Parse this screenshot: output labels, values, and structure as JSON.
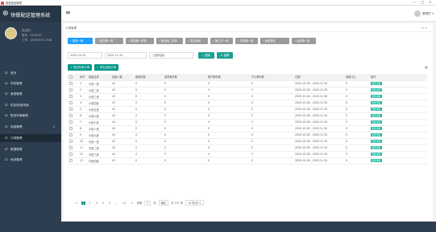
{
  "window": {
    "title": "智慧配送管理",
    "controls": [
      "—",
      "□",
      "×"
    ]
  },
  "sidebar": {
    "app_title": "快餐配送管理系统",
    "logo_icon": "food-cart",
    "user": {
      "line1": "欢迎您！",
      "line2": "账号：1919191",
      "line3": "工号：19091919 1536"
    },
    "items": [
      {
        "label": "首页",
        "icon": "home-icon"
      },
      {
        "label": "学校管理",
        "icon": "school-icon"
      },
      {
        "label": "食堂管理",
        "icon": "canteen-icon"
      },
      {
        "label": "供应商/配送商",
        "icon": "supplier-icon"
      },
      {
        "label": "配送车辆管理",
        "icon": "truck-icon"
      },
      {
        "label": "班级管理",
        "icon": "class-icon",
        "expand": "∨"
      },
      {
        "label": "订单管理",
        "icon": "order-icon",
        "active": true
      },
      {
        "label": "数据管理",
        "icon": "data-icon"
      },
      {
        "label": "系统管理",
        "icon": "settings-icon"
      }
    ]
  },
  "header": {
    "menu_icon": "hamburger-icon",
    "user_name": "管理员 ∨"
  },
  "panel": {
    "title": "订单管理",
    "controls": "⟳ ×",
    "tabs": [
      {
        "label": "菜品一单",
        "active": true
      },
      {
        "label": "配送单一单"
      },
      {
        "label": "菜品第一供单"
      },
      {
        "label": "配送第二供单"
      },
      {
        "label": "供应商单"
      },
      {
        "label": "第三方一单"
      },
      {
        "label": "学校单一单"
      },
      {
        "label": "食堂单位"
      },
      {
        "label": "全部单一单"
      }
    ],
    "filters": {
      "date_start": "2020-10-28",
      "date_end": "2020-11-30",
      "select": "--全部班级--",
      "search_label": "搜索",
      "reset_label": "重置"
    },
    "actions": {
      "export_label": "导出所有订单",
      "print_label": "导出选择订单",
      "settings_icon": "grid-icon"
    },
    "table": {
      "headers": [
        "序号",
        "班级名称",
        "班级人数",
        "套餐份数",
        "营养餐份数",
        "额外餐份数",
        "不订餐份数",
        "日期",
        "退款(元)",
        "操作"
      ],
      "action_label": "修改详情",
      "rows": [
        [
          "1",
          "小班一班",
          "42",
          "0",
          "0",
          "0",
          "0",
          "2020-10-28 - 2020-11-30",
          "0"
        ],
        [
          "2",
          "小班二班",
          "42",
          "0",
          "0",
          "0",
          "0",
          "2020-10-28 - 2020-11-30",
          "0"
        ],
        [
          "3",
          "小班三班",
          "42",
          "0",
          "0",
          "0",
          "0",
          "2020-10-28 - 2020-11-30",
          "0"
        ],
        [
          "4",
          "小班四班",
          "42",
          "0",
          "0",
          "0",
          "0",
          "2020-10-28 - 2020-11-30",
          "0"
        ],
        [
          "5",
          "小班五班",
          "42",
          "0",
          "0",
          "0",
          "0",
          "2020-10-28 - 2020-11-30",
          "0"
        ],
        [
          "6",
          "小班六班",
          "42",
          "0",
          "0",
          "0",
          "0",
          "2020-10-28 - 2020-11-30",
          "0"
        ],
        [
          "7",
          "小班七班",
          "44",
          "0",
          "0",
          "0",
          "0",
          "2020-10-28 - 2020-11-30",
          "0"
        ],
        [
          "8",
          "小班八班",
          "44",
          "0",
          "0",
          "0",
          "0",
          "2020-10-28 - 2020-11-30",
          "0"
        ],
        [
          "9",
          "小班九班",
          "43",
          "0",
          "0",
          "0",
          "0",
          "2020-10-28 - 2020-11-30",
          "0"
        ],
        [
          "10",
          "中班一班",
          "42",
          "0",
          "0",
          "0",
          "0",
          "2020-10-28 - 2020-11-30",
          "0"
        ],
        [
          "11",
          "中班二班",
          "42",
          "0",
          "0",
          "0",
          "0",
          "2020-10-28 - 2020-11-30",
          "0"
        ],
        [
          "12",
          "中班三班",
          "42",
          "0",
          "0",
          "0",
          "0",
          "2020-10-28 - 2020-11-30",
          "0"
        ],
        [
          "13",
          "中班四班",
          "42",
          "0",
          "0",
          "0",
          "0",
          "2020-10-28 - 2020-11-30",
          "0"
        ]
      ]
    },
    "pager": {
      "prev": "<",
      "pages": [
        "1",
        "2",
        "3",
        "4",
        "5",
        "…",
        "11"
      ],
      "next": ">",
      "goto_label": "到第",
      "goto_value": "1",
      "page_unit": "页",
      "confirm_label": "确定",
      "total": "共 131 条",
      "page_size": "10 条/页 ∨"
    }
  }
}
